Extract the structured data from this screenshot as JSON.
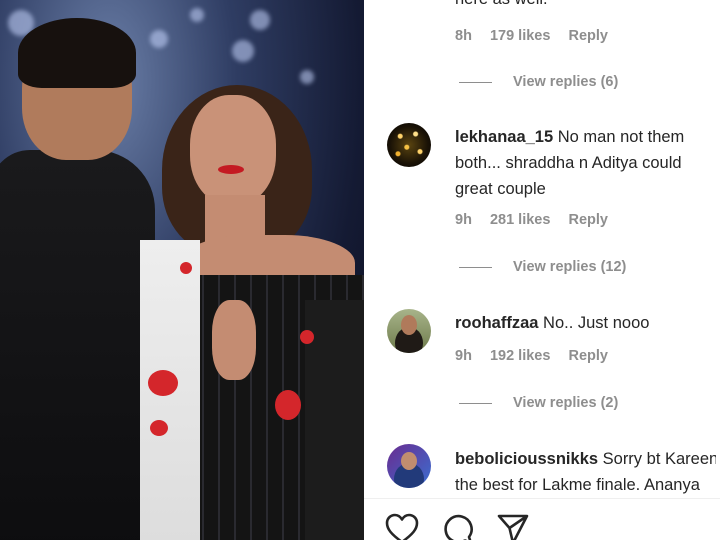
{
  "comments": [
    {
      "lines": [
        "here as well."
      ],
      "time": "8h",
      "likes": "179 likes",
      "reply": "Reply",
      "view_replies": "View replies (6)"
    },
    {
      "username": "lekhanaa_15",
      "lines": [
        " No man not them",
        "both... shraddha n Aditya could",
        "great couple"
      ],
      "time": "9h",
      "likes": "281 likes",
      "reply": "Reply",
      "view_replies": "View replies (12)"
    },
    {
      "username": "roohaffzaa",
      "lines": [
        " No.. Just nooo"
      ],
      "time": "9h",
      "likes": "192 likes",
      "reply": "Reply",
      "view_replies": "View replies (2)"
    },
    {
      "username": "bebolicioussnikks",
      "lines": [
        " Sorry bt Kareena",
        "the best for Lakme finale. Ananya"
      ]
    }
  ],
  "actions": {
    "like_icon": "heart-icon",
    "comment_icon": "comment-icon",
    "share_icon": "paper-plane-icon"
  }
}
